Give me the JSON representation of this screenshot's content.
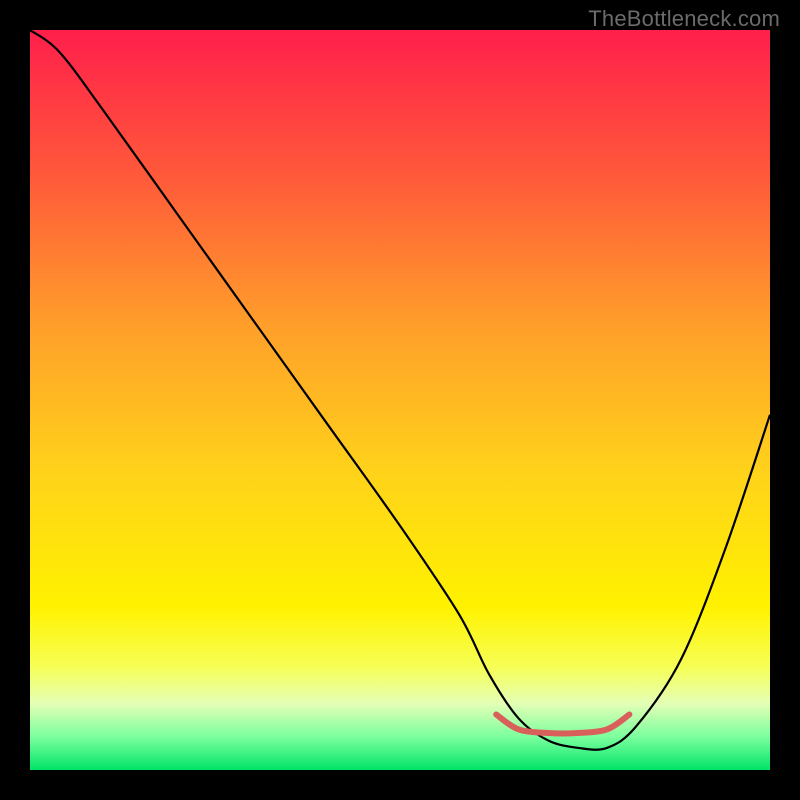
{
  "watermark": "TheBottleneck.com",
  "chart_data": {
    "type": "line",
    "title": "",
    "xlabel": "",
    "ylabel": "",
    "xlim": [
      0,
      100
    ],
    "ylim": [
      0,
      100
    ],
    "grid": false,
    "legend": false,
    "gradient_stops": [
      {
        "offset": 0.0,
        "color": "#ff1f4b"
      },
      {
        "offset": 0.2,
        "color": "#ff5a3a"
      },
      {
        "offset": 0.4,
        "color": "#ff9f2a"
      },
      {
        "offset": 0.6,
        "color": "#ffd31a"
      },
      {
        "offset": 0.78,
        "color": "#fff200"
      },
      {
        "offset": 0.86,
        "color": "#f7ff55"
      },
      {
        "offset": 0.91,
        "color": "#e4ffb6"
      },
      {
        "offset": 0.955,
        "color": "#7cff9e"
      },
      {
        "offset": 1.0,
        "color": "#00e468"
      }
    ],
    "series": [
      {
        "name": "bottleneck-curve",
        "stroke": "#000000",
        "stroke_width": 2.2,
        "x": [
          0,
          4,
          10,
          20,
          30,
          40,
          50,
          58,
          62,
          66,
          70,
          74,
          78,
          82,
          88,
          94,
          100
        ],
        "values": [
          100,
          97,
          89,
          75,
          61,
          47,
          33,
          21,
          13,
          7,
          4,
          3,
          3,
          6,
          15,
          30,
          48
        ]
      },
      {
        "name": "optimal-range-marker",
        "stroke": "#d9605a",
        "stroke_width": 6,
        "cap": "round",
        "x": [
          63,
          66,
          70,
          74,
          78,
          81
        ],
        "values": [
          7.5,
          5.5,
          5.0,
          5.0,
          5.5,
          7.5
        ]
      }
    ]
  }
}
